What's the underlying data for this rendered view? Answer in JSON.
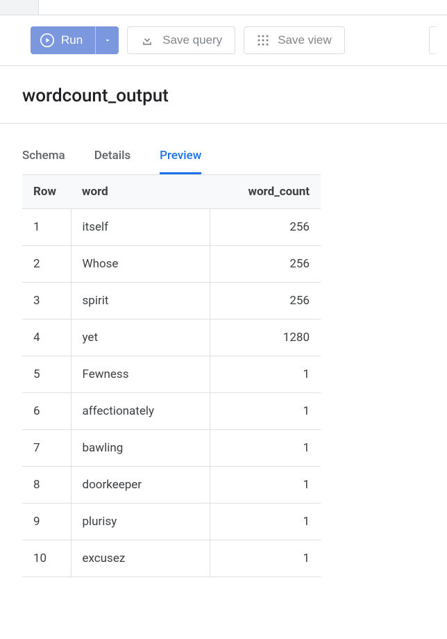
{
  "toolbar": {
    "run_label": "Run",
    "save_query_label": "Save query",
    "save_view_label": "Save view"
  },
  "title": "wordcount_output",
  "tabs": {
    "schema": "Schema",
    "details": "Details",
    "preview": "Preview",
    "active": "preview"
  },
  "table": {
    "headers": {
      "row": "Row",
      "word": "word",
      "word_count": "word_count"
    },
    "rows": [
      {
        "row": 1,
        "word": "itself",
        "word_count": 256
      },
      {
        "row": 2,
        "word": "Whose",
        "word_count": 256
      },
      {
        "row": 3,
        "word": "spirit",
        "word_count": 256
      },
      {
        "row": 4,
        "word": "yet",
        "word_count": 1280
      },
      {
        "row": 5,
        "word": "Fewness",
        "word_count": 1
      },
      {
        "row": 6,
        "word": "affectionately",
        "word_count": 1
      },
      {
        "row": 7,
        "word": "bawling",
        "word_count": 1
      },
      {
        "row": 8,
        "word": "doorkeeper",
        "word_count": 1
      },
      {
        "row": 9,
        "word": "plurisy",
        "word_count": 1
      },
      {
        "row": 10,
        "word": "excusez",
        "word_count": 1
      }
    ]
  }
}
